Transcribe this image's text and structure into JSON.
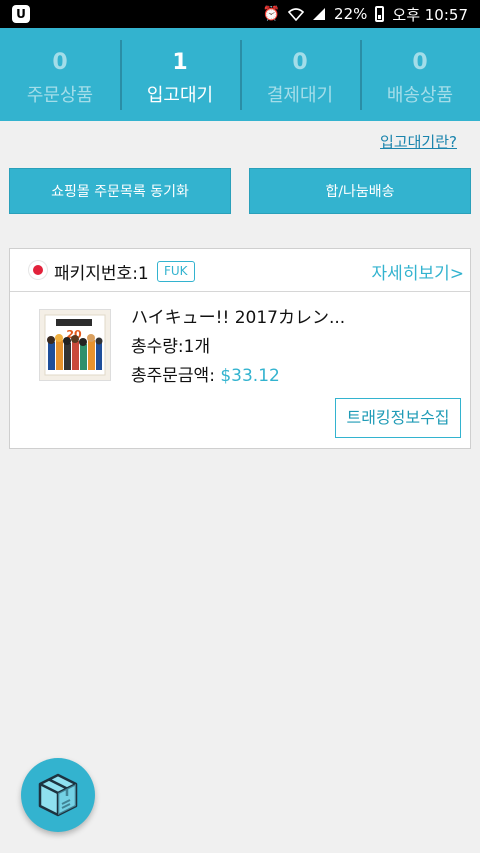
{
  "status_bar": {
    "app_badge": "U",
    "battery_percent": "22%",
    "clock": "오후 10:57",
    "icons": [
      "alarm-icon",
      "wifi-icon",
      "signal-icon",
      "battery-icon"
    ]
  },
  "tabs": [
    {
      "count": "0",
      "label": "주문상품",
      "active": false
    },
    {
      "count": "1",
      "label": "입고대기",
      "active": true
    },
    {
      "count": "0",
      "label": "결제대기",
      "active": false
    },
    {
      "count": "0",
      "label": "배송상품",
      "active": false
    }
  ],
  "help_link": "입고대기란?",
  "buttons": {
    "sync": "쇼핑몰 주문목록 동기화",
    "merge": "합/나눔배송"
  },
  "package": {
    "number": "패키지번호:1",
    "tag": "FUK",
    "detail_link": "자세히보기>",
    "item_name": "ハイキュー!! 2017カレン...",
    "quantity": "총수량:1개",
    "total_label": "총주문금액: ",
    "total_price": "$33.12",
    "tracking_button": "트래킹정보수집"
  },
  "colors": {
    "accent": "#33b3cf",
    "link": "#1a84ad",
    "flag_red": "#e2213a"
  },
  "fab_icon": "package-box-icon"
}
